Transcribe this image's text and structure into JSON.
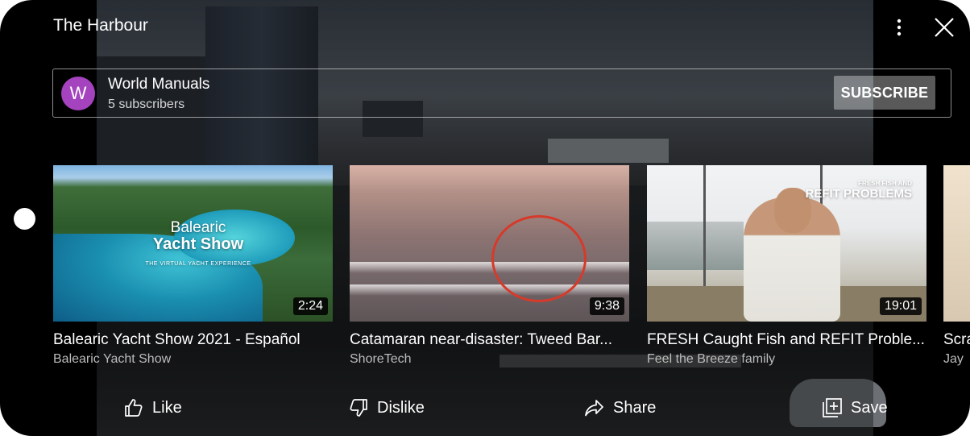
{
  "header": {
    "title": "The Harbour"
  },
  "channel": {
    "avatar_letter": "W",
    "avatar_color": "#a543bf",
    "name": "World Manuals",
    "subscribers": "5 subscribers",
    "subscribe_label": "SUBSCRIBE"
  },
  "videos": [
    {
      "title": "Balearic Yacht Show 2021 - Español",
      "channel": "Balearic Yacht Show",
      "duration": "2:24",
      "thumb_text_1": "Balearic",
      "thumb_text_2": "Yacht Show",
      "thumb_text_3": "THE VIRTUAL YACHT EXPERIENCE"
    },
    {
      "title": "Catamaran near-disaster: Tweed Bar...",
      "channel": "ShoreTech",
      "duration": "9:38"
    },
    {
      "title": "FRESH Caught Fish and REFIT Proble...",
      "channel": "Feel the Breeze family",
      "duration": "19:01",
      "thumb_text_1": "FRESH FISH AND",
      "thumb_text_2": "REFIT PROBLEMS"
    },
    {
      "title": "Scra",
      "channel": "Jay"
    }
  ],
  "actions": {
    "like": "Like",
    "dislike": "Dislike",
    "share": "Share",
    "save": "Save"
  }
}
